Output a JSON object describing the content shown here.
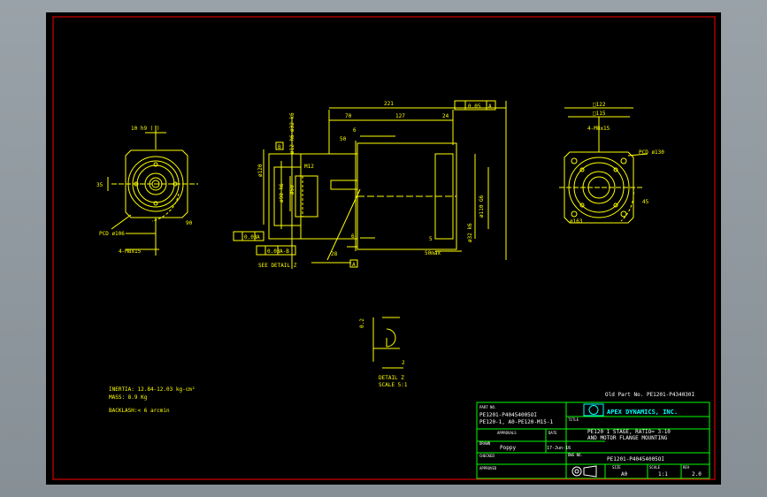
{
  "drawing": {
    "dims": {
      "d221": "221",
      "d70": "70",
      "d127": "127",
      "d24": "24",
      "d50": "50",
      "d6": "6",
      "d28": "28",
      "d5": "5",
      "d50max": "50max",
      "d12": "12",
      "d2": "2",
      "d0_2": "0.2",
      "m12": "M12",
      "dia120": "ø120",
      "dia90": "ø90 h6",
      "dia50": "ø50",
      "dia110": "ø110 G6",
      "dia32": "ø32 k6",
      "dia12": "ø12 h6",
      "dia32b": "ø32 k6",
      "d35": "35",
      "d90": "90",
      "d45": "45",
      "sq122": "□122",
      "sq115": "□115",
      "holes_front": "4-M8x15",
      "holes_back": "4-M8x15",
      "pcd106": "PCD ø106",
      "pcd130": "PCD ø130",
      "dia163": "ø163",
      "key": "10 h9 (  )",
      "see_detail": "SEE DETAIL Z",
      "tol1": "0.05",
      "tol2": "0.03",
      "tol3": "0.03",
      "dtm_a": "A",
      "dtm_b": "B",
      "dtm_ab": "A-B"
    },
    "detail_label": "DETAIL Z",
    "detail_scale": "SCALE 5:1",
    "notes": [
      "INERTIA: 12.84-12.03 kg-cm²",
      "MASS: 8.9 Kg",
      "BACKLASH:< 6 arcmin"
    ],
    "old_part": "Old Part No. PE1201-P434030I"
  },
  "title_block": {
    "part_no_label": "PART NO.",
    "part_no_line1": "PE1201-P40454005OI",
    "part_no_line2": "PE120-1, A0-PE120-M15-1",
    "company": "APEX DYNAMICS, INC.",
    "title_label": "TITLE",
    "title_line1": "PE120 1 STAGE, RATIO= 3-10",
    "title_line2": "AND MOTOR FLANGE MOUNTING",
    "drawn_label": "DRAWN",
    "drawn_by": "Poppy",
    "date_label": "DATE",
    "date": "17-Jun-16",
    "approvals_label": "APPROVALS",
    "checked_label": "CHECKED",
    "dwg_label": "DWG NO.",
    "dwg_no": "PE1201-P40454005OI",
    "approved_label": "APPROVED",
    "size_label": "SIZE",
    "size": "A0",
    "scale_label": "SCALE",
    "scale": "1:1",
    "rev_label": "REV",
    "rev": "2.0"
  },
  "colors": {
    "border": "#ff0000",
    "geometry": "#ffff00",
    "block": "#00ff00",
    "text": "#ffffff",
    "company": "#00ffff",
    "background": "#000000"
  }
}
